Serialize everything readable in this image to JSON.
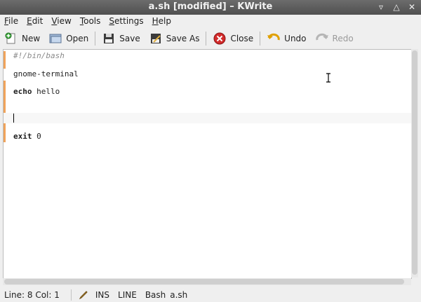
{
  "window": {
    "title": "a.sh [modified] – KWrite"
  },
  "menu": {
    "items": [
      {
        "pre": "",
        "u": "F",
        "post": "ile"
      },
      {
        "pre": "",
        "u": "E",
        "post": "dit"
      },
      {
        "pre": "",
        "u": "V",
        "post": "iew"
      },
      {
        "pre": "",
        "u": "T",
        "post": "ools"
      },
      {
        "pre": "",
        "u": "S",
        "post": "ettings"
      },
      {
        "pre": "",
        "u": "H",
        "post": "elp"
      }
    ]
  },
  "toolbar": {
    "new": "New",
    "open": "Open",
    "save": "Save",
    "save_as": "Save As",
    "close": "Close",
    "undo": "Undo",
    "redo": "Redo"
  },
  "editor": {
    "line1": "#!/bin/bash",
    "line3": "gnome-terminal",
    "line5_kw": "echo",
    "line5_rest": " hello",
    "line10_kw": "exit",
    "line10_rest": " 0"
  },
  "status": {
    "position": "Line: 8 Col: 1",
    "mode": "INS",
    "selection": "LINE",
    "syntax": "Bash",
    "file": "a.sh"
  },
  "icons": {
    "accent": "#f0a35a"
  }
}
